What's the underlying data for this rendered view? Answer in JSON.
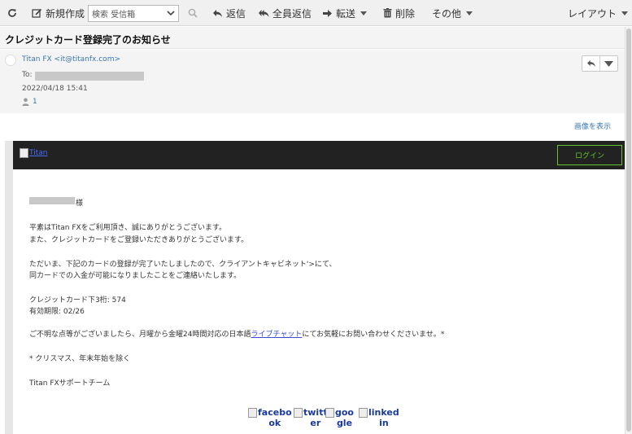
{
  "toolbar": {
    "new_label": "新規作成",
    "folder_value": "検索 受信箱",
    "reply_label": "返信",
    "reply_all_label": "全員返信",
    "forward_label": "転送",
    "delete_label": "削除",
    "more_label": "その他",
    "layout_label": "レイアウト"
  },
  "message": {
    "subject": "クレジットカード登録完了のお知らせ",
    "from": "Titan FX <it@titanfx.com>",
    "to_label": "To:",
    "date": "2022/04/18 15:41",
    "recipient_count": "1",
    "show_images": "画像を表示"
  },
  "email": {
    "logo_alt": "Titan",
    "login_label": "ログイン",
    "salutation": "様",
    "p1_line1": "平素はTitan FXをご利用頂き、誠にありがとうございます。",
    "p1_line2": "また、クレジットカードをご登録いただきありがとうございます。",
    "p2_line1": "ただいま、下記のカードの登録が完了いたしましたので、クライアントキャビネット'>にて、",
    "p2_line2": "同カードでの入金が可能になりましたことをご連絡いたします。",
    "card_last3": "クレジットカード下3桁: 574",
    "expiry": "有効期限: 02/26",
    "contact_pre": "ご不明な点等がございましたら、月曜から金曜24時間対応の日本語",
    "contact_link": "ライブチャット",
    "contact_post": "にてお気軽にお問い合わせくださいませ。*",
    "note": "* クリスマス、年末年始を除く",
    "signature": "Titan FXサポートチーム",
    "social": {
      "facebook_1": "facebo",
      "facebook_2": "ok",
      "twitter_1": "twitt",
      "twitter_2": "er",
      "google_1": "goo",
      "google_2": "gle",
      "linkedin_1": "linked",
      "linkedin_2": "in"
    }
  }
}
